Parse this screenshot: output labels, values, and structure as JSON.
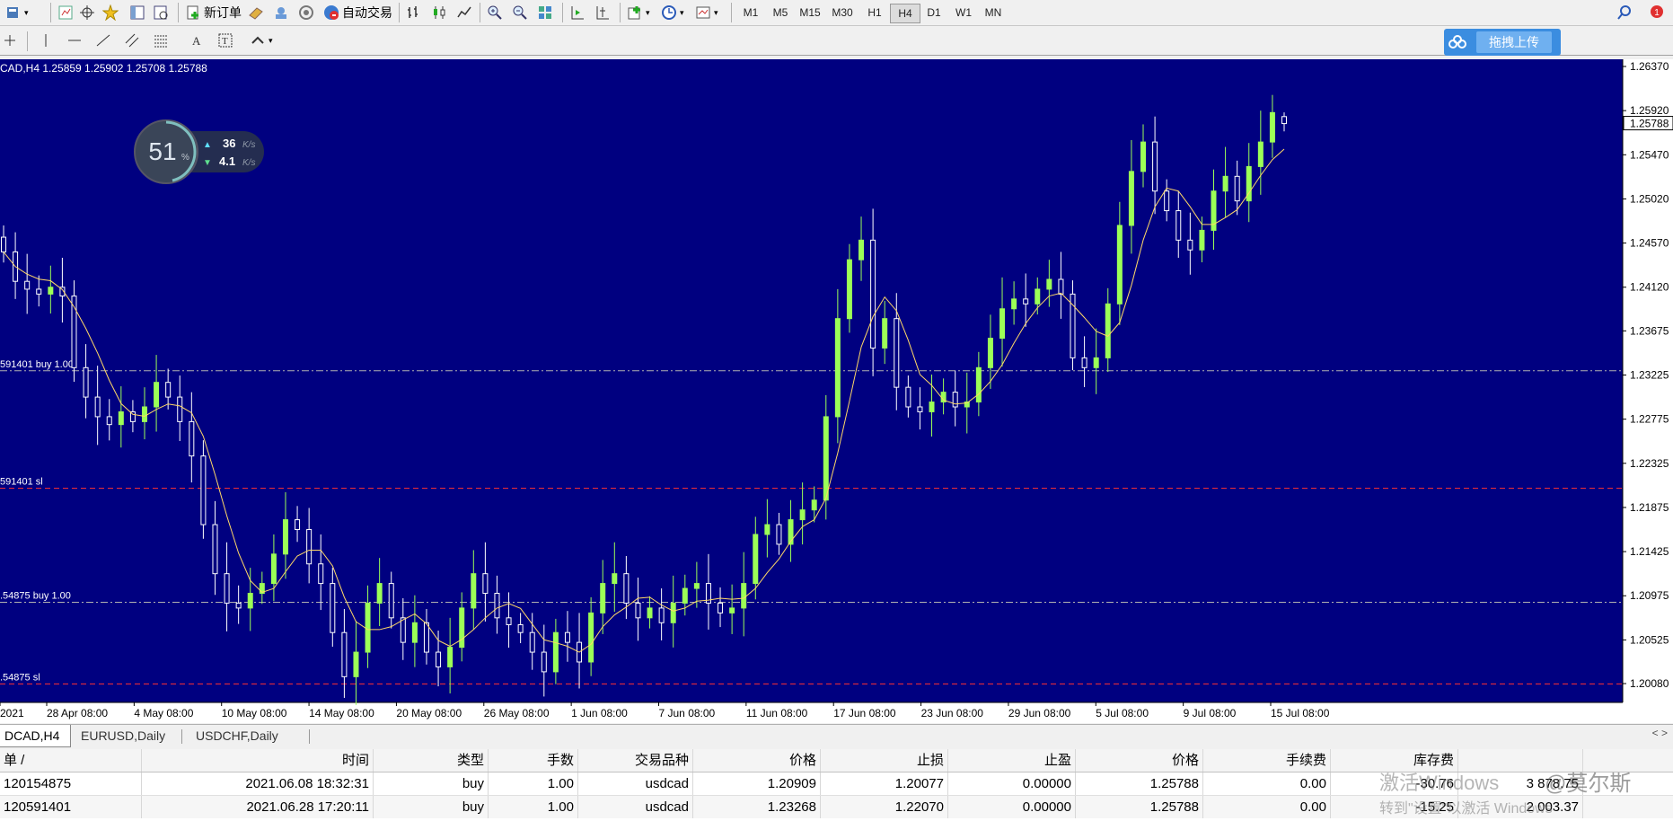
{
  "toolbar": {
    "new_order": "新订单",
    "auto_trading": "自动交易",
    "timeframes": [
      "M1",
      "M5",
      "M15",
      "M30",
      "H1",
      "H4",
      "D1",
      "W1",
      "MN"
    ],
    "active_timeframe": "H4",
    "notification_count": "1"
  },
  "upload_button": {
    "label": "拖拽上传"
  },
  "speed_widget": {
    "percent": "51",
    "percent_unit": "%",
    "upload": "36",
    "upload_unit": "K/s",
    "download": "4.1",
    "download_unit": "K/s"
  },
  "chart": {
    "header": "CAD,H4  1.25859 1.25902 1.25708 1.25788",
    "colors": {
      "background": "#000080",
      "up_candle": "#9cff57",
      "down_candle": "#ffffff",
      "ma": "#ffd966",
      "order_line": "#b0b0b0",
      "sl_line": "#ff3030"
    },
    "price_labels": [
      "1.26370",
      "1.25920",
      "1.25470",
      "1.25020",
      "1.24570",
      "1.24120",
      "1.23675",
      "1.23225",
      "1.22775",
      "1.22325",
      "1.21875",
      "1.21425",
      "1.20975",
      "1.20525",
      "1.20080"
    ],
    "current_price": "1.25788",
    "time_labels": [
      "2021",
      "28 Apr 08:00",
      "4 May 08:00",
      "10 May 08:00",
      "14 May 08:00",
      "20 May 08:00",
      "26 May 08:00",
      "1 Jun 08:00",
      "7 Jun 08:00",
      "11 Jun 08:00",
      "17 Jun 08:00",
      "23 Jun 08:00",
      "29 Jun 08:00",
      "5 Jul 08:00",
      "9 Jul 08:00",
      "15 Jul 08:00"
    ],
    "order_lines": [
      {
        "label": "591401 buy 1.00",
        "price": 1.23268,
        "kind": "order"
      },
      {
        "label": "591401 sl",
        "price": 1.2207,
        "kind": "sl"
      },
      {
        "label": ".54875 buy 1.00",
        "price": 1.20909,
        "kind": "order"
      },
      {
        "label": ".54875 sl",
        "price": 1.20077,
        "kind": "sl"
      }
    ]
  },
  "chart_data": {
    "type": "candlestick",
    "title": "CAD,H4",
    "ylim": [
      1.2008,
      1.2637
    ],
    "closes": [
      1.2448,
      1.2418,
      1.241,
      1.2405,
      1.2412,
      1.2403,
      1.233,
      1.23,
      1.228,
      1.2272,
      1.2285,
      1.2275,
      1.229,
      1.2315,
      1.23,
      1.2275,
      1.224,
      1.217,
      1.212,
      1.209,
      1.2085,
      1.21,
      1.211,
      1.214,
      1.2175,
      1.2165,
      1.213,
      1.211,
      1.206,
      1.2015,
      1.204,
      1.209,
      1.211,
      1.2075,
      1.205,
      1.207,
      1.204,
      1.2025,
      1.2045,
      1.2085,
      1.212,
      1.21,
      1.2075,
      1.2068,
      1.206,
      1.204,
      1.202,
      1.206,
      1.205,
      1.203,
      1.208,
      1.211,
      1.212,
      1.209,
      1.2075,
      1.2085,
      1.207,
      1.209,
      1.2105,
      1.211,
      1.209,
      1.208,
      1.2085,
      1.211,
      1.216,
      1.217,
      1.215,
      1.2175,
      1.2185,
      1.2195,
      1.228,
      1.238,
      1.244,
      1.246,
      1.235,
      1.238,
      1.231,
      1.229,
      1.2285,
      1.2295,
      1.2305,
      1.229,
      1.2295,
      1.233,
      1.236,
      1.239,
      1.24,
      1.2395,
      1.241,
      1.242,
      1.2405,
      1.234,
      1.233,
      1.234,
      1.2395,
      1.2475,
      1.253,
      1.256,
      1.251,
      1.249,
      1.246,
      1.245,
      1.247,
      1.251,
      1.2525,
      1.25,
      1.2535,
      1.256,
      1.259,
      1.2579
    ],
    "last_bar": {
      "open": 1.25859,
      "high": 1.25902,
      "low": 1.25708,
      "close": 1.25788
    }
  },
  "symbol_tabs": [
    "DCAD,H4",
    "EURUSD,Daily",
    "USDCHF,Daily"
  ],
  "orders_table": {
    "columns": [
      "单 /",
      "时间",
      "类型",
      "手数",
      "交易品种",
      "价格",
      "止损",
      "止盈",
      "价格",
      "手续费",
      "库存费",
      ""
    ],
    "rows": [
      [
        "120154875",
        "2021.06.08 18:32:31",
        "buy",
        "1.00",
        "usdcad",
        "1.20909",
        "1.20077",
        "0.00000",
        "1.25788",
        "0.00",
        "-30.76",
        "3 878.75"
      ],
      [
        "120591401",
        "2021.06.28 17:20:11",
        "buy",
        "1.00",
        "usdcad",
        "1.23268",
        "1.22070",
        "0.00000",
        "1.25788",
        "0.00",
        "-15.25",
        "2 003.37"
      ]
    ]
  },
  "watermark": {
    "line1": "激活Windows",
    "line2": "转到\"设置\"以激活 Windows",
    "brand": "@莫尔斯"
  }
}
